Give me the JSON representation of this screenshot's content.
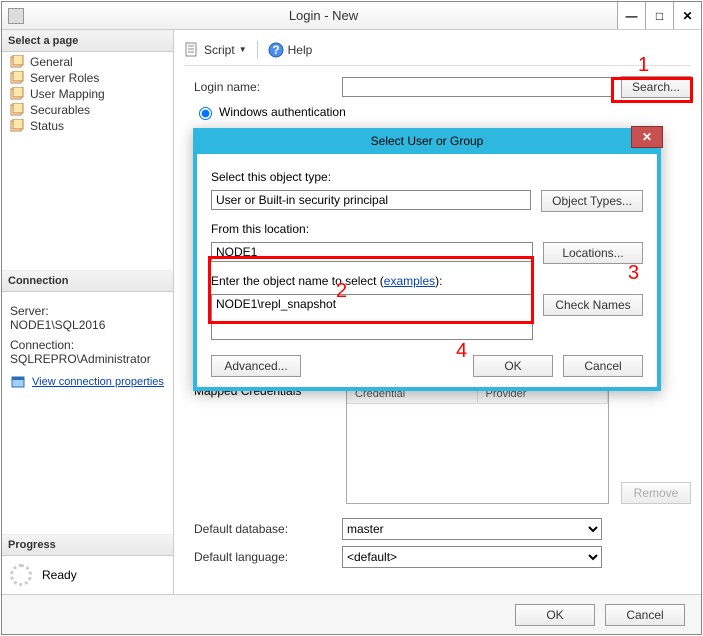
{
  "window": {
    "title": "Login - New"
  },
  "sidebar": {
    "select_page_header": "Select a page",
    "pages": [
      "General",
      "Server Roles",
      "User Mapping",
      "Securables",
      "Status"
    ],
    "connection_header": "Connection",
    "server_label": "Server:",
    "server_value": "NODE1\\SQL2016",
    "connection_label": "Connection:",
    "connection_value": "SQLREPRO\\Administrator",
    "view_properties": "View connection properties",
    "progress_header": "Progress",
    "progress_status": "Ready"
  },
  "toolbar": {
    "script": "Script",
    "help": "Help"
  },
  "main": {
    "login_name_label": "Login name:",
    "login_name_value": "",
    "search_button": "Search...",
    "windows_auth": "Windows authentication",
    "mapped_credentials": "Mapped Credentials",
    "col_credential": "Credential",
    "col_provider": "Provider",
    "remove_button": "Remove",
    "default_db_label": "Default database:",
    "default_db_value": "master",
    "default_lang_label": "Default language:",
    "default_lang_value": "<default>"
  },
  "dialog": {
    "title": "Select User or Group",
    "object_type_label": "Select this object type:",
    "object_type_value": "User or Built-in security principal",
    "object_types_button": "Object Types...",
    "location_label": "From this location:",
    "location_value": "NODE1",
    "locations_button": "Locations...",
    "names_label": "Enter the object name to select ",
    "examples_link": "examples",
    "names_value": "NODE1\\repl_snapshot",
    "check_names_button": "Check Names",
    "advanced_button": "Advanced...",
    "ok": "OK",
    "cancel": "Cancel"
  },
  "buttons": {
    "ok": "OK",
    "cancel": "Cancel"
  },
  "annotations": {
    "n1": "1",
    "n2": "2",
    "n3": "3",
    "n4": "4"
  }
}
